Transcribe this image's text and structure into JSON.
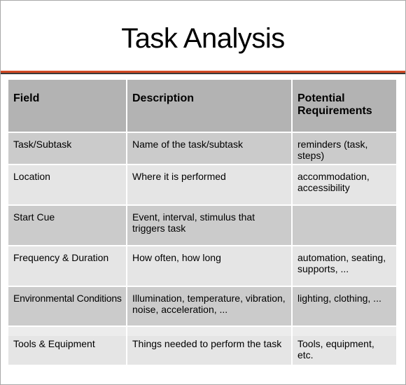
{
  "slide": {
    "title": "Task Analysis"
  },
  "table": {
    "headers": [
      "Field",
      "Description",
      "Potential Requirements"
    ],
    "rows": [
      {
        "field": "Task/Subtask",
        "description": "Name of the task/subtask",
        "requirements": "reminders (task, steps)"
      },
      {
        "field": "Location",
        "description": "Where it is performed",
        "requirements": "accommodation, accessibility"
      },
      {
        "field": "Start Cue",
        "description": "Event, interval, stimulus that triggers task",
        "requirements": ""
      },
      {
        "field": "Frequency & Duration",
        "description": "How often, how long",
        "requirements": "automation, seating, supports, ..."
      },
      {
        "field": "Environmental Conditions",
        "description": "Illumination, temperature, vibration, noise, acceleration, ...",
        "requirements": "lighting, clothing, ..."
      },
      {
        "field": "Tools & Equipment",
        "description": "Things needed to perform the task",
        "requirements": "Tools, equipment, etc."
      }
    ]
  },
  "colors": {
    "accent_rule": "#d24a25",
    "header_bg": "#b3b3b3",
    "row_dark": "#cbcbcb",
    "row_light": "#e5e5e5"
  }
}
